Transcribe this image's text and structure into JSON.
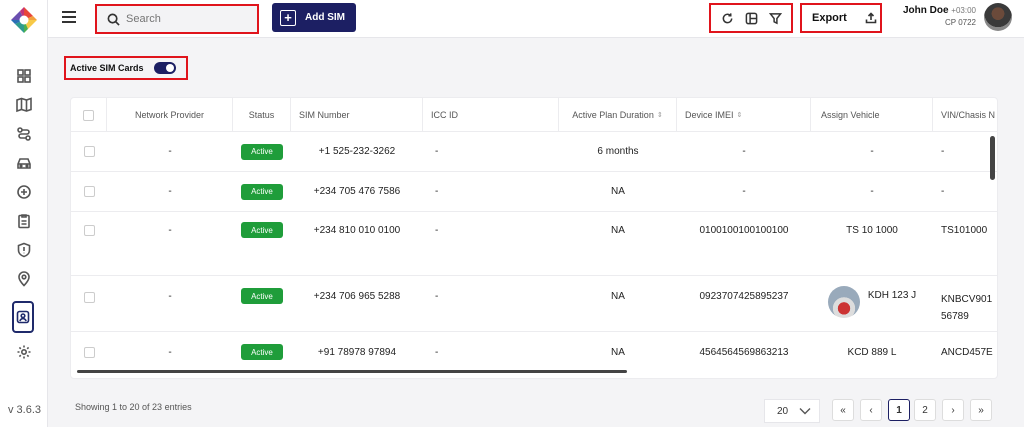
{
  "app": {
    "version": "v 3.6.3"
  },
  "sidebar": {
    "items": [
      {
        "icon": "grid-icon"
      },
      {
        "icon": "map-icon"
      },
      {
        "icon": "route-icon"
      },
      {
        "icon": "car-icon"
      },
      {
        "icon": "device-icon"
      },
      {
        "icon": "clipboard-icon"
      },
      {
        "icon": "alert-icon"
      },
      {
        "icon": "location-pin-icon"
      },
      {
        "icon": "sim-card-icon",
        "active": true
      },
      {
        "icon": "gear-icon"
      }
    ]
  },
  "topbar": {
    "search_placeholder": "Search",
    "add_sim_label": "Add SIM",
    "export_label": "Export",
    "user": {
      "name": "John Doe",
      "timezone": "+03:00",
      "code": "CP 0722"
    }
  },
  "filters": {
    "active_sim_label": "Active SIM Cards",
    "active_sim_enabled": true
  },
  "table": {
    "columns": [
      "Network Provider",
      "Status",
      "SIM Number",
      "ICC ID",
      "Active Plan Duration",
      "Device IMEI",
      "Assign Vehicle",
      "VIN/Chasis N"
    ],
    "rows": [
      {
        "provider": "-",
        "status": "Active",
        "sim": "+1 525-232-3262",
        "icc": "-",
        "duration": "6 months",
        "imei": "-",
        "vehicle": "-",
        "vin": "-"
      },
      {
        "provider": "-",
        "status": "Active",
        "sim": "+234 705 476 7586",
        "icc": "-",
        "duration": "NA",
        "imei": "-",
        "vehicle": "-",
        "vin": "-"
      },
      {
        "provider": "-",
        "status": "Active",
        "sim": "+234 810 010 0100",
        "icc": "-",
        "duration": "NA",
        "imei": "0100100100100100",
        "vehicle": "TS 10 1000",
        "vin": "TS101000"
      },
      {
        "provider": "-",
        "status": "Active",
        "sim": "+234 706 965 5288",
        "icc": "-",
        "duration": "NA",
        "imei": "0923707425895237",
        "vehicle": "KDH 123 J",
        "vin": "KNBCV901 56789"
      },
      {
        "provider": "-",
        "status": "Active",
        "sim": "+91 78978 97894",
        "icc": "-",
        "duration": "NA",
        "imei": "4564564569863213",
        "vehicle": "KCD 889 L",
        "vin": "ANCD457E"
      }
    ]
  },
  "footer": {
    "showing": "Showing 1 to 20 of 23 entries",
    "per_page": "20",
    "pages": [
      "1",
      "2"
    ],
    "current_page": "1"
  }
}
